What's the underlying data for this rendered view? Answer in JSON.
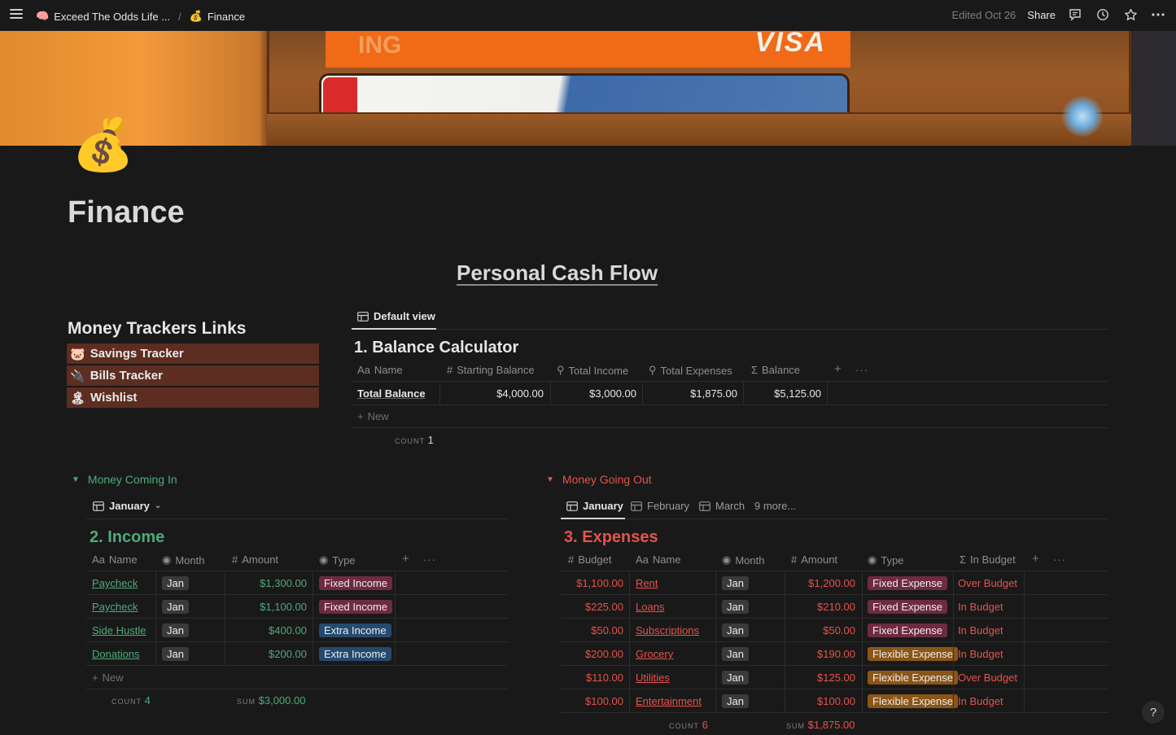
{
  "topbar": {
    "breadcrumb_parent": "Exceed The Odds Life ...",
    "breadcrumb_parent_icon": "🧠",
    "breadcrumb_current": "Finance",
    "breadcrumb_current_icon": "💰",
    "separator": "/",
    "edited": "Edited Oct 26",
    "share": "Share"
  },
  "page": {
    "icon": "💰",
    "title": "Finance",
    "cashflow_title": "Personal Cash Flow"
  },
  "links": {
    "title": "Money Trackers Links",
    "items": [
      {
        "icon": "🐷",
        "label": "Savings Tracker"
      },
      {
        "icon": "🔌",
        "label": "Bills Tracker"
      },
      {
        "icon": "🏝",
        "label": "Wishlist"
      }
    ]
  },
  "balance": {
    "view_label": "Default view",
    "title": "1. Balance Calculator",
    "headers": [
      "Name",
      "Starting Balance",
      "Total Income",
      "Total Expenses",
      "Balance"
    ],
    "row": {
      "name": "Total Balance",
      "starting": "$4,000.00",
      "income": "$3,000.00",
      "expenses": "$1,875.00",
      "balance": "$5,125.00"
    },
    "new_label": "New",
    "count_label": "COUNT",
    "count": "1"
  },
  "income": {
    "section_label": "Money Coming In",
    "view_label": "January",
    "title": "2. Income",
    "headers": [
      "Name",
      "Month",
      "Amount",
      "Type"
    ],
    "rows": [
      {
        "name": "Paycheck",
        "month": "Jan",
        "amount": "$1,300.00",
        "type": "Fixed Income"
      },
      {
        "name": "Paycheck",
        "month": "Jan",
        "amount": "$1,100.00",
        "type": "Fixed Income"
      },
      {
        "name": "Side Hustle",
        "month": "Jan",
        "amount": "$400.00",
        "type": "Extra Income"
      },
      {
        "name": "Donations",
        "month": "Jan",
        "amount": "$200.00",
        "type": "Extra Income"
      }
    ],
    "new_label": "New",
    "count_label": "COUNT",
    "count": "4",
    "sum_label": "SUM",
    "sum": "$3,000.00"
  },
  "expenses": {
    "section_label": "Money Going Out",
    "tabs": [
      "January",
      "February",
      "March",
      "9 more..."
    ],
    "title": "3. Expenses",
    "headers": [
      "Budget",
      "Name",
      "Month",
      "Amount",
      "Type",
      "In Budget"
    ],
    "rows": [
      {
        "budget": "$1,100.00",
        "name": "Rent",
        "month": "Jan",
        "amount": "$1,200.00",
        "type": "Fixed Expense",
        "status": "Over Budget"
      },
      {
        "budget": "$225.00",
        "name": "Loans",
        "month": "Jan",
        "amount": "$210.00",
        "type": "Fixed Expense",
        "status": "In Budget"
      },
      {
        "budget": "$50.00",
        "name": "Subscriptions",
        "month": "Jan",
        "amount": "$50.00",
        "type": "Fixed Expense",
        "status": "In Budget"
      },
      {
        "budget": "$200.00",
        "name": "Grocery",
        "month": "Jan",
        "amount": "$190.00",
        "type": "Flexible Expense",
        "status": "In Budget"
      },
      {
        "budget": "$110.00",
        "name": "Utilities",
        "month": "Jan",
        "amount": "$125.00",
        "type": "Flexible Expense",
        "status": "Over Budget"
      },
      {
        "budget": "$100.00",
        "name": "Entertainment",
        "month": "Jan",
        "amount": "$100.00",
        "type": "Flexible Expense",
        "status": "In Budget"
      }
    ],
    "count_label": "COUNT",
    "count": "6",
    "sum_label": "SUM",
    "sum": "$1,875.00"
  },
  "colors": {
    "green": "#4dab7a",
    "red": "#e5534b",
    "link_bg": "#5c2d20"
  },
  "help": "?"
}
